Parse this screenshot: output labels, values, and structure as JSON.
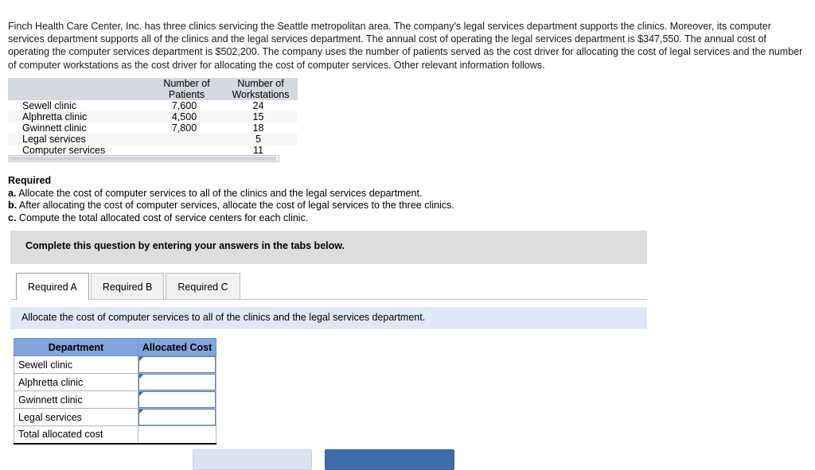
{
  "problem": {
    "statement": "Finch Health Care Center, Inc. has three clinics servicing the Seattle metropolitan area. The company's legal services department supports the clinics. Moreover, its computer services department supports all of the clinics and the legal services department. The annual cost of operating the legal services department is $347,550. The annual cost of operating the computer services department is $502,200. The company uses the number of patients served as the cost driver for allocating the cost of legal services and the number of computer workstations as the cost driver for allocating the cost of computer services. Other relevant information follows."
  },
  "data_table": {
    "headers": {
      "blank": "",
      "patients_line1": "Number of",
      "patients_line2": "Patients",
      "workstations_line1": "Number of",
      "workstations_line2": "Workstations"
    },
    "rows": [
      {
        "label": "Sewell clinic",
        "patients": "7,600",
        "workstations": "24"
      },
      {
        "label": "Alphretta clinic",
        "patients": "4,500",
        "workstations": "15"
      },
      {
        "label": "Gwinnett clinic",
        "patients": "7,800",
        "workstations": "18"
      },
      {
        "label": "Legal services",
        "patients": "",
        "workstations": "5"
      },
      {
        "label": "Computer services",
        "patients": "",
        "workstations": "11"
      }
    ]
  },
  "required": {
    "title": "Required",
    "items": [
      {
        "marker": "a.",
        "text": "Allocate the cost of computer services to all of the clinics and the legal services department."
      },
      {
        "marker": "b.",
        "text": "After allocating the cost of computer services, allocate the cost of legal services to the three clinics."
      },
      {
        "marker": "c.",
        "text": "Compute the total allocated cost of service centers for each clinic."
      }
    ]
  },
  "banner": {
    "text": "Complete this question by entering your answers in the tabs below."
  },
  "tabs": [
    {
      "label": "Required A",
      "active": true
    },
    {
      "label": "Required B",
      "active": false
    },
    {
      "label": "Required C",
      "active": false
    }
  ],
  "instruction": {
    "text": "Allocate the cost of computer services to all of the clinics and the legal services department."
  },
  "answer_table": {
    "headers": {
      "department": "Department",
      "allocated_cost": "Allocated Cost"
    },
    "rows": [
      {
        "department": "Sewell clinic",
        "allocated_cost": ""
      },
      {
        "department": "Alphretta clinic",
        "allocated_cost": ""
      },
      {
        "department": "Gwinnett clinic",
        "allocated_cost": ""
      },
      {
        "department": "Legal services",
        "allocated_cost": ""
      },
      {
        "department": "Total allocated cost",
        "allocated_cost": ""
      }
    ]
  },
  "colors": {
    "answer_header_blue": "#7fa6dc",
    "instruction_bar_blue": "#dee9f7",
    "banner_gray": "#dddddd",
    "data_header_gray": "#d4d8e0",
    "next_button_blue": "#3f6cab",
    "prev_button_light": "#dae3f0"
  }
}
